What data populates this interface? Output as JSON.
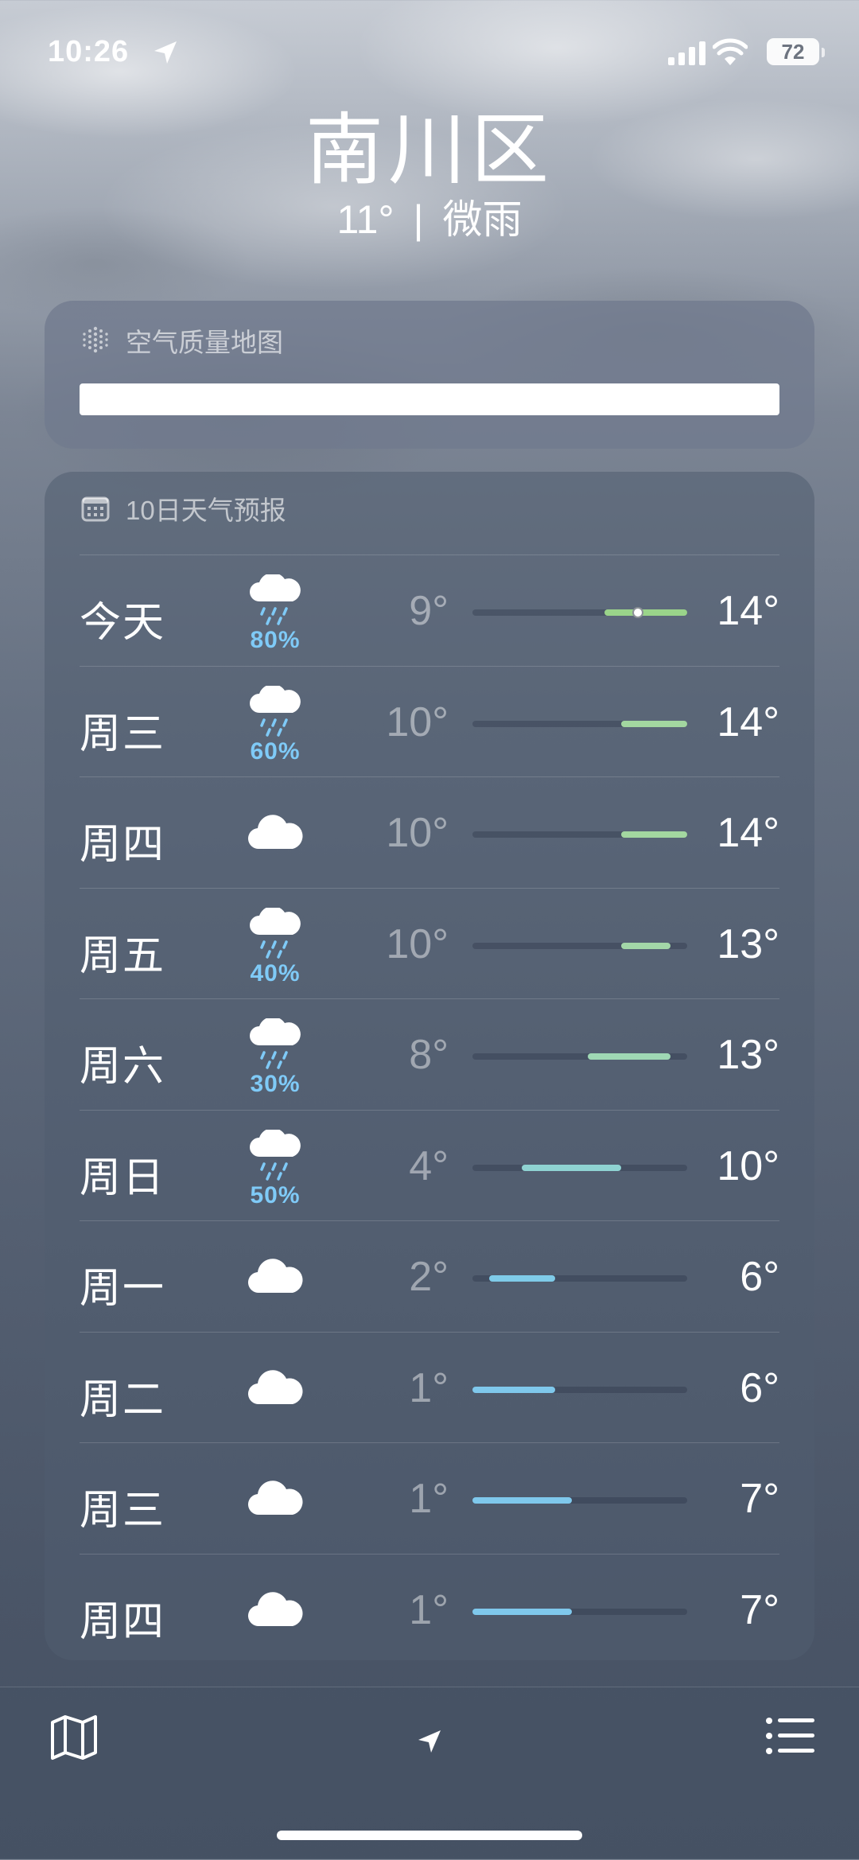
{
  "status_bar": {
    "time": "10:26",
    "battery": "72"
  },
  "header": {
    "city": "南川区",
    "temperature": "11°",
    "separator": "|",
    "condition": "微雨"
  },
  "air_quality": {
    "title": "空气质量地图",
    "icon": "air-quality-icon"
  },
  "forecast": {
    "title": "10日天气预报",
    "icon": "calendar-icon",
    "range_min": 1,
    "range_max": 14,
    "days": [
      {
        "day": "今天",
        "icon": "cloud-rain-icon",
        "precip": "80%",
        "low": "9°",
        "high": "14°",
        "low_val": 9,
        "high_val": 14,
        "current": 11,
        "color": "#9ad48a"
      },
      {
        "day": "周三",
        "icon": "cloud-rain-icon",
        "precip": "60%",
        "low": "10°",
        "high": "14°",
        "low_val": 10,
        "high_val": 14,
        "color": "#a3d7a0"
      },
      {
        "day": "周四",
        "icon": "cloud-icon",
        "precip": "",
        "low": "10°",
        "high": "14°",
        "low_val": 10,
        "high_val": 14,
        "color": "#a3d7a0"
      },
      {
        "day": "周五",
        "icon": "cloud-rain-icon",
        "precip": "40%",
        "low": "10°",
        "high": "13°",
        "low_val": 10,
        "high_val": 13,
        "color": "#a3d7a8"
      },
      {
        "day": "周六",
        "icon": "cloud-rain-icon",
        "precip": "30%",
        "low": "8°",
        "high": "13°",
        "low_val": 8,
        "high_val": 13,
        "color": "#9fd8b4"
      },
      {
        "day": "周日",
        "icon": "cloud-rain-icon",
        "precip": "50%",
        "low": "4°",
        "high": "10°",
        "low_val": 4,
        "high_val": 10,
        "color": "#8fd3d2"
      },
      {
        "day": "周一",
        "icon": "cloud-icon",
        "precip": "",
        "low": "2°",
        "high": "6°",
        "low_val": 2,
        "high_val": 6,
        "color": "#7fcbe8"
      },
      {
        "day": "周二",
        "icon": "cloud-icon",
        "precip": "",
        "low": "1°",
        "high": "6°",
        "low_val": 1,
        "high_val": 6,
        "color": "#7fc8ec"
      },
      {
        "day": "周三",
        "icon": "cloud-icon",
        "precip": "",
        "low": "1°",
        "high": "7°",
        "low_val": 1,
        "high_val": 7,
        "color": "#7fc8ec"
      },
      {
        "day": "周四",
        "icon": "cloud-icon",
        "precip": "",
        "low": "1°",
        "high": "7°",
        "low_val": 1,
        "high_val": 7,
        "color": "#7fc8ec"
      }
    ]
  },
  "toolbar": {
    "map": "map-icon",
    "location": "location-arrow-icon",
    "list": "list-icon"
  }
}
